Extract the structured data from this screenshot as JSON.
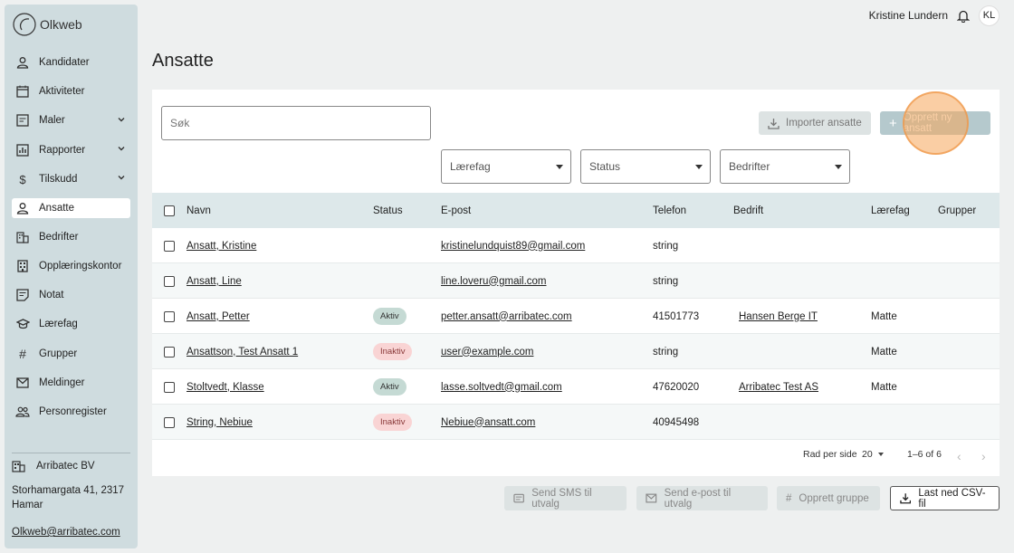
{
  "app": {
    "name": "Olkweb"
  },
  "user": {
    "name": "Kristine Lundern",
    "initials": "KL"
  },
  "sidebar": {
    "items": [
      {
        "label": "Kandidater",
        "icon": "person-icon",
        "expandable": false,
        "active": false
      },
      {
        "label": "Aktiviteter",
        "icon": "calendar-icon",
        "expandable": false,
        "active": false
      },
      {
        "label": "Maler",
        "icon": "template-icon",
        "expandable": true,
        "active": false
      },
      {
        "label": "Rapporter",
        "icon": "chart-icon",
        "expandable": true,
        "active": false
      },
      {
        "label": "Tilskudd",
        "icon": "dollar-icon",
        "expandable": true,
        "active": false
      },
      {
        "label": "Ansatte",
        "icon": "person-icon",
        "expandable": false,
        "active": true
      },
      {
        "label": "Bedrifter",
        "icon": "building-icon",
        "expandable": false,
        "active": false
      },
      {
        "label": "Opplæringskontor",
        "icon": "office-icon",
        "expandable": false,
        "active": false
      },
      {
        "label": "Notat",
        "icon": "note-icon",
        "expandable": false,
        "active": false
      },
      {
        "label": "Lærefag",
        "icon": "school-icon",
        "expandable": false,
        "active": false
      },
      {
        "label": "Grupper",
        "icon": "hash-icon",
        "expandable": false,
        "active": false
      },
      {
        "label": "Meldinger",
        "icon": "mail-icon",
        "expandable": false,
        "active": false
      },
      {
        "label": "Personregister",
        "icon": "people-icon",
        "expandable": false,
        "active": false
      }
    ],
    "company": "Arribatec BV",
    "address": "Storhamargata 41, 2317 Hamar",
    "email": "Olkweb@arribatec.com"
  },
  "page": {
    "title": "Ansatte"
  },
  "toolbar": {
    "search_placeholder": "Søk",
    "import_label": "Importer ansatte",
    "create_label": "Opprett ny ansatt"
  },
  "filters": {
    "laerefag": "Lærefag",
    "status": "Status",
    "bedrifter": "Bedrifter"
  },
  "table": {
    "headers": {
      "navn": "Navn",
      "status": "Status",
      "epost": "E-post",
      "telefon": "Telefon",
      "bedrift": "Bedrift",
      "laerefag": "Lærefag",
      "grupper": "Grupper"
    },
    "rows": [
      {
        "navn": "Ansatt, Kristine",
        "status": "",
        "status_type": "",
        "epost": "kristinelundquist89@gmail.com",
        "telefon": "string",
        "bedrift": "",
        "laerefag": ""
      },
      {
        "navn": "Ansatt, Line",
        "status": "",
        "status_type": "",
        "epost": "line.loveru@gmail.com",
        "telefon": "string",
        "bedrift": "",
        "laerefag": ""
      },
      {
        "navn": "Ansatt, Petter",
        "status": "Aktiv",
        "status_type": "aktiv",
        "epost": "petter.ansatt@arribatec.com",
        "telefon": "41501773",
        "bedrift": "Hansen Berge IT",
        "laerefag": "Matte"
      },
      {
        "navn": "Ansattson, Test Ansatt 1",
        "status": "Inaktiv",
        "status_type": "inaktiv",
        "epost": "user@example.com",
        "telefon": "string",
        "bedrift": "",
        "laerefag": "Matte"
      },
      {
        "navn": "Stoltvedt, Klasse",
        "status": "Aktiv",
        "status_type": "aktiv",
        "epost": "lasse.soltvedt@gmail.com",
        "telefon": "47620020",
        "bedrift": "Arribatec Test AS",
        "laerefag": "Matte"
      },
      {
        "navn": "String, Nebiue",
        "status": "Inaktiv",
        "status_type": "inaktiv",
        "epost": "Nebiue@ansatt.com",
        "telefon": "40945498",
        "bedrift": "",
        "laerefag": ""
      }
    ]
  },
  "pagination": {
    "rows_per_page_label": "Rad per side",
    "rows_per_page": "20",
    "range": "1–6 of 6"
  },
  "actions": {
    "sms_label": "Send SMS til utvalg",
    "email_label": "Send e-post til utvalg",
    "group_label": "Opprett gruppe",
    "csv_label": "Last ned CSV-fil"
  },
  "colors": {
    "sidebar_bg": "#cfdcdf",
    "header_bg": "#dde8ea",
    "aktiv": "#c5dad4",
    "inaktiv": "#f9d4d4",
    "highlight": "#f5a65a"
  }
}
